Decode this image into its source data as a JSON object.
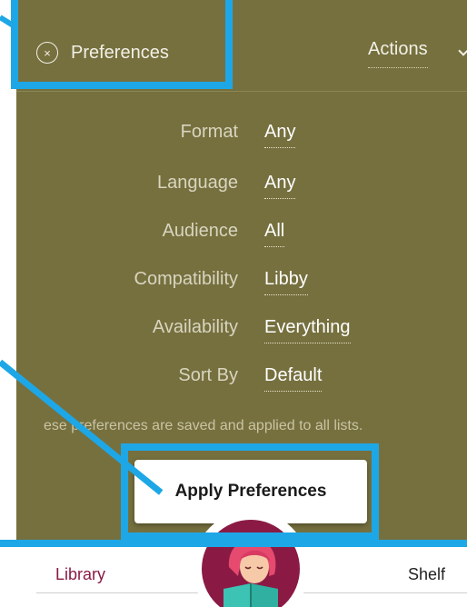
{
  "header": {
    "title": "Preferences",
    "close_glyph": "×",
    "actions_label": "Actions"
  },
  "preferences": [
    {
      "label": "Format",
      "value": "Any"
    },
    {
      "label": "Language",
      "value": "Any"
    },
    {
      "label": "Audience",
      "value": "All"
    },
    {
      "label": "Compatibility",
      "value": "Libby"
    },
    {
      "label": "Availability",
      "value": "Everything"
    },
    {
      "label": "Sort By",
      "value": "Default"
    }
  ],
  "note": "ese preferences are saved and applied to all lists.",
  "apply_button": "Apply Preferences",
  "nav": {
    "library_label": "Library",
    "shelf_label": "Shelf",
    "logo_icon": "libby-reader-logo-icon"
  },
  "colors": {
    "panel": "#76703f",
    "highlight": "#1ea7e6",
    "brand": "#8a1a44"
  }
}
